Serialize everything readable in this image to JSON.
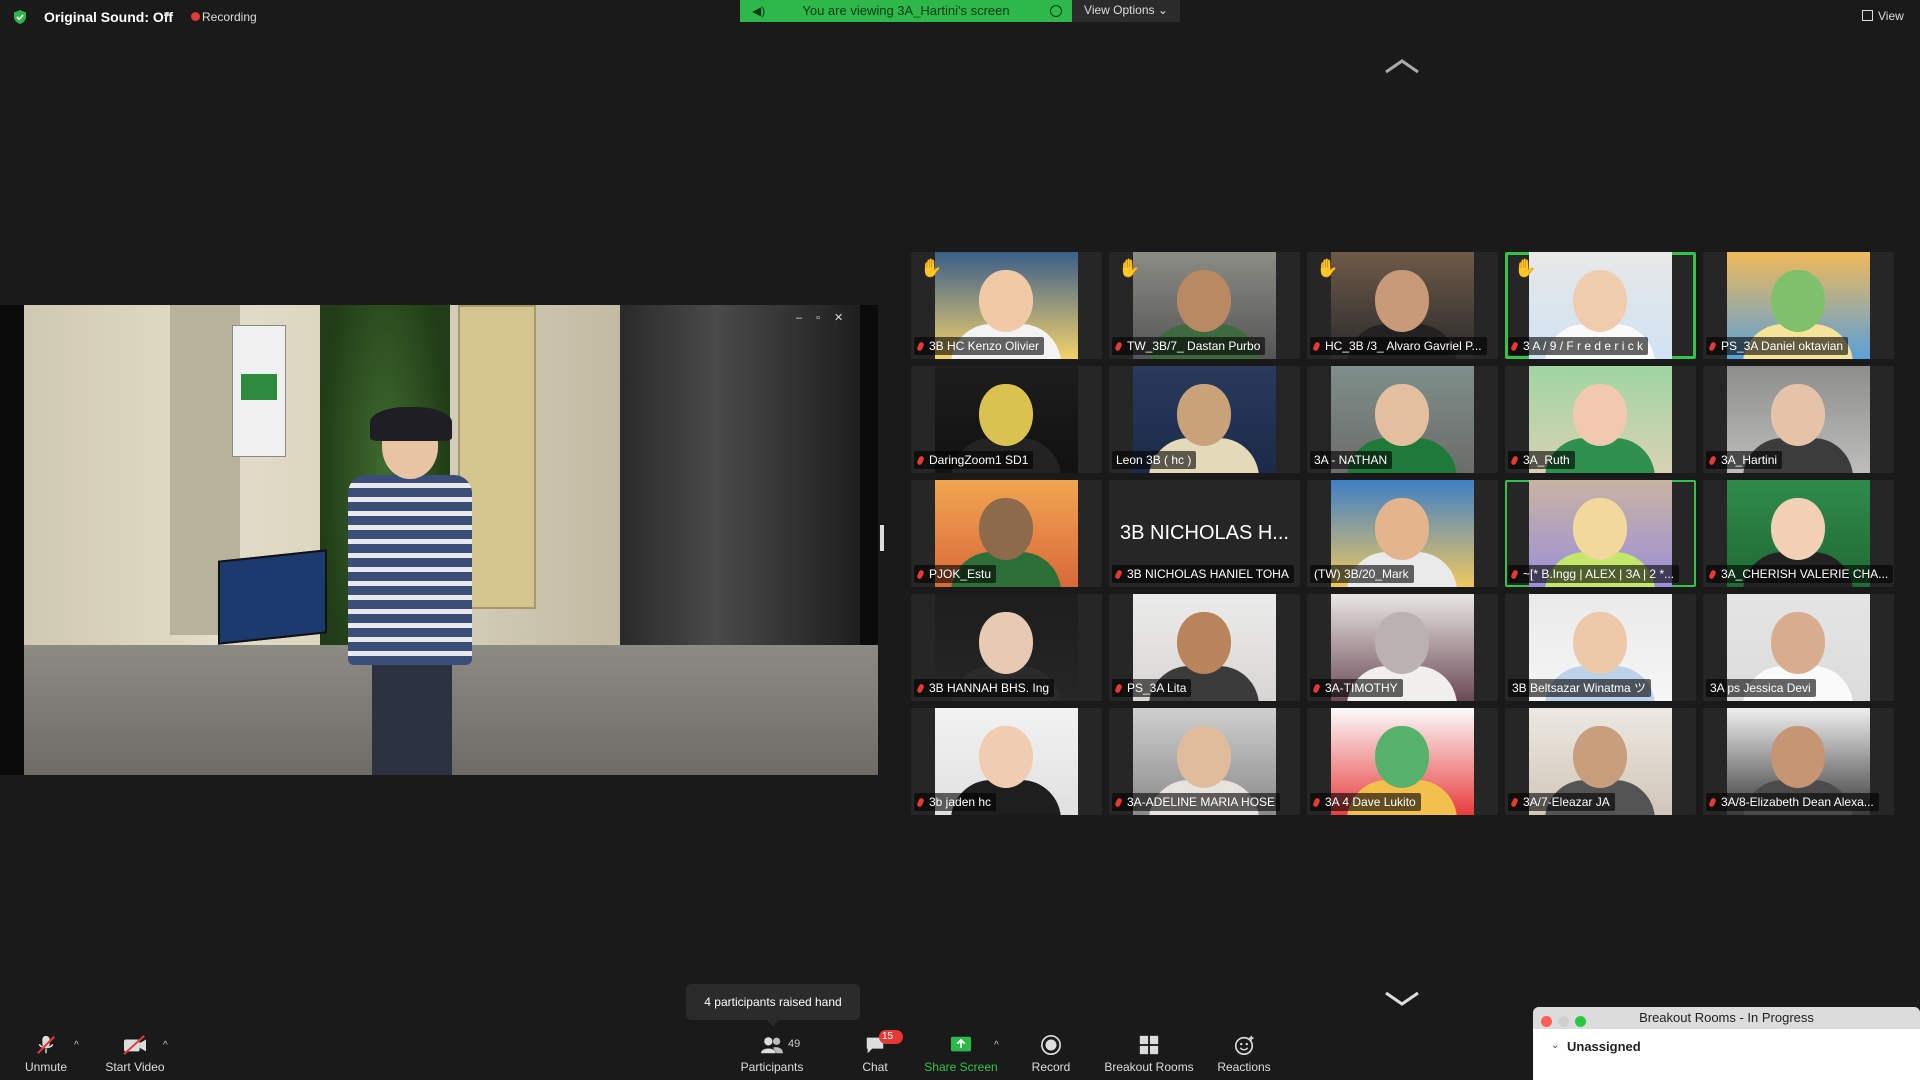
{
  "topbar": {
    "original_sound": "Original Sound: Off",
    "recording": "Recording",
    "viewing_banner": "You are viewing 3A_Hartini's screen",
    "view_options": "View Options",
    "view": "View"
  },
  "colors": {
    "accent_green": "#35c24a",
    "banner_green": "#2fb84a",
    "recording_red": "#e53935",
    "background": "#1a1a1a"
  },
  "icons": [
    "shield-icon",
    "caret-down-icon",
    "record-dot-icon",
    "speaker-icon",
    "chevron-up-icon",
    "chevron-down-icon",
    "grid-view-icon",
    "mic-muted-icon",
    "video-off-icon",
    "participants-icon",
    "chat-icon",
    "share-screen-icon",
    "record-icon",
    "breakout-rooms-icon",
    "reactions-icon",
    "raised-hand-icon"
  ],
  "gallery": {
    "tiles": [
      {
        "name": "3B HC Kenzo Olivier",
        "hand": true,
        "muted": true
      },
      {
        "name": "TW_3B/7_ Dastan Purbo",
        "hand": true,
        "muted": true
      },
      {
        "name": "HC_3B /3_ Alvaro Gavriel P...",
        "hand": true,
        "muted": true
      },
      {
        "name": "3 A / 9 / F r e d e r i c k",
        "hand": true,
        "muted": true,
        "active": true
      },
      {
        "name": "PS_3A Daniel oktavian",
        "hand": false,
        "muted": true
      },
      {
        "name": "DaringZoom1 SD1",
        "hand": false,
        "muted": true
      },
      {
        "name": "Leon 3B ( hc )",
        "hand": false,
        "muted": false
      },
      {
        "name": "3A - NATHAN",
        "hand": false,
        "muted": false
      },
      {
        "name": "3A_Ruth",
        "hand": false,
        "muted": true
      },
      {
        "name": "3A_Hartini",
        "hand": false,
        "muted": true
      },
      {
        "name": "PJOK_Estu",
        "hand": false,
        "muted": true
      },
      {
        "name": "3B NICHOLAS HANIEL TOHA",
        "hand": false,
        "muted": true,
        "big_text": "3B NICHOLAS H..."
      },
      {
        "name": "(TW) 3B/20_Mark",
        "hand": false,
        "muted": false
      },
      {
        "name": "~[* B.Ingg | ALEX | 3A | 2 *...",
        "hand": false,
        "muted": true,
        "speak": true
      },
      {
        "name": "3A_CHERISH VALERIE CHA...",
        "hand": false,
        "muted": true
      },
      {
        "name": "3B HANNAH BHS. Ing",
        "hand": false,
        "muted": true
      },
      {
        "name": "PS_3A Lita",
        "hand": false,
        "muted": true
      },
      {
        "name": "3A-TIMOTHY",
        "hand": false,
        "muted": true
      },
      {
        "name": "3B Beltsazar Winatma ツ",
        "hand": false,
        "muted": false
      },
      {
        "name": "3A ps Jessica Devi",
        "hand": false,
        "muted": false
      },
      {
        "name": "3b jaden hc",
        "hand": false,
        "muted": true
      },
      {
        "name": "3A-ADELINE MARIA HOSE",
        "hand": false,
        "muted": true
      },
      {
        "name": "3A 4 Dave Lukito",
        "hand": false,
        "muted": true
      },
      {
        "name": "3A/7-Eleazar JA",
        "hand": false,
        "muted": true
      },
      {
        "name": "3A/8-Elizabeth Dean Alexa...",
        "hand": false,
        "muted": true
      }
    ]
  },
  "toolbar": {
    "unmute": "Unmute",
    "start_video": "Start Video",
    "participants": "Participants",
    "participants_count": "49",
    "chat": "Chat",
    "chat_badge": "15",
    "share_screen": "Share Screen",
    "record": "Record",
    "breakout_rooms": "Breakout Rooms",
    "reactions": "Reactions"
  },
  "tooltip": "4 participants raised hand",
  "breakout_panel": {
    "title": "Breakout Rooms - In Progress",
    "unassigned": "Unassigned"
  }
}
